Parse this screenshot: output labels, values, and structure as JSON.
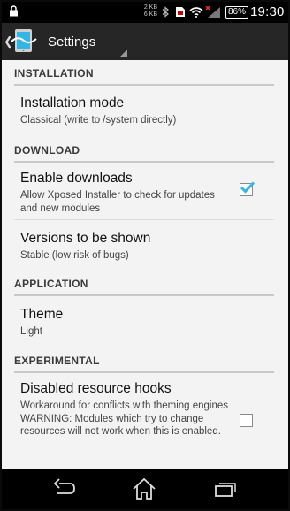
{
  "status_bar": {
    "net_up": "2 KB",
    "net_down": "6 KB",
    "battery": "86%",
    "time": "19:30",
    "icons": [
      "lock-icon",
      "bluetooth-icon",
      "sim-icon",
      "wifi-icon",
      "signal-icon"
    ]
  },
  "action_bar": {
    "title": "Settings"
  },
  "sections": [
    {
      "header": "INSTALLATION"
    },
    {
      "header": "DOWNLOAD"
    },
    {
      "header": "APPLICATION"
    },
    {
      "header": "EXPERIMENTAL"
    }
  ],
  "prefs": {
    "installation_mode": {
      "title": "Installation mode",
      "summary": "Classical (write to /system directly)"
    },
    "enable_downloads": {
      "title": "Enable downloads",
      "summary": "Allow Xposed Installer to check for updates and new modules",
      "checked": true
    },
    "versions_shown": {
      "title": "Versions to be shown",
      "summary": "Stable (low risk of bugs)"
    },
    "theme": {
      "title": "Theme",
      "summary": "Light"
    },
    "disabled_resource_hooks": {
      "title": "Disabled resource hooks",
      "summary": "Workaround for conflicts with theming engines\nWARNING: Modules which try to change resources will not work when this is enabled.",
      "checked": false
    }
  },
  "nav_bar": {
    "icons": [
      "back-icon",
      "home-icon",
      "recents-icon"
    ]
  },
  "colors": {
    "accent": "#33b5e5",
    "action_bar": "#262626",
    "background": "#f3f3f3"
  }
}
